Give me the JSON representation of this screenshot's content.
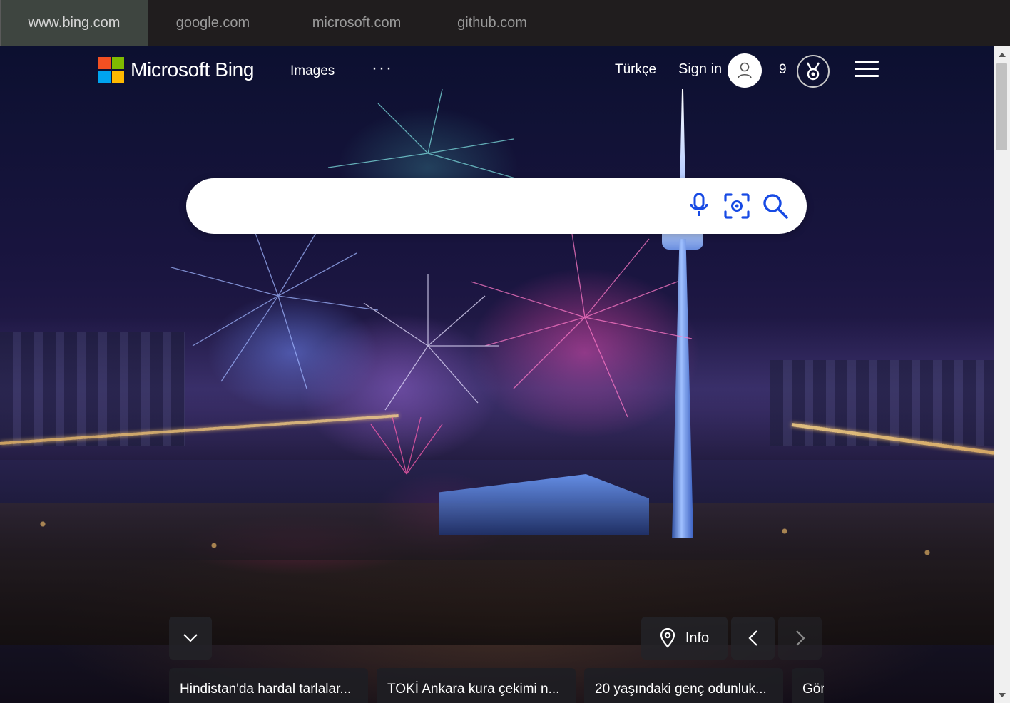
{
  "browser": {
    "tabs": [
      {
        "label": "www.bing.com",
        "active": true
      },
      {
        "label": "google.com",
        "active": false
      },
      {
        "label": "microsoft.com",
        "active": false
      },
      {
        "label": "github.com",
        "active": false
      }
    ]
  },
  "header": {
    "logo_text": "Microsoft Bing",
    "logo_colors": [
      "#f25022",
      "#7fba00",
      "#00a4ef",
      "#ffb900"
    ],
    "nav_images": "Images",
    "nav_more": "···",
    "language": "Türkçe",
    "sign_in": "Sign in",
    "reward_points": "9"
  },
  "search": {
    "placeholder": "",
    "value": "",
    "accent_color": "#174ae4"
  },
  "image_controls": {
    "info_label": "Info"
  },
  "news": [
    {
      "title": "Hindistan'da hardal tarlalar..."
    },
    {
      "title": "TOKİ Ankara kura çekimi n..."
    },
    {
      "title": "20 yaşındaki genç odunluk..."
    },
    {
      "title": "Gör"
    }
  ]
}
